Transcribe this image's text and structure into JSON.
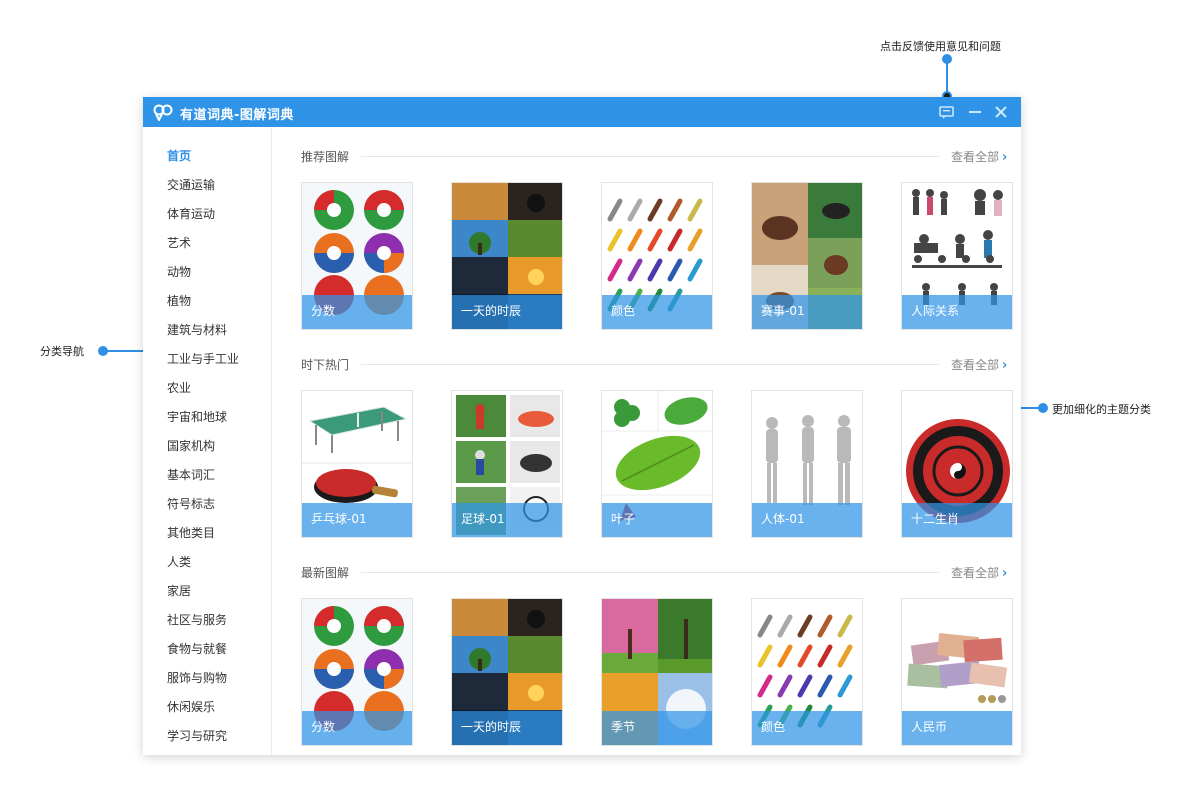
{
  "annotations": {
    "feedback": "点击反馈使用意见和问题",
    "nav": "分类导航",
    "subcategory": "更加细化的主题分类"
  },
  "window": {
    "title": "有道词典-图解词典"
  },
  "titlebar_icons": [
    "feedback-icon",
    "minimize-icon",
    "close-icon"
  ],
  "sidebar": {
    "items": [
      {
        "label": "首页",
        "active": true
      },
      {
        "label": "交通运输"
      },
      {
        "label": "体育运动"
      },
      {
        "label": "艺术"
      },
      {
        "label": "动物"
      },
      {
        "label": "植物"
      },
      {
        "label": "建筑与材料"
      },
      {
        "label": "工业与手工业"
      },
      {
        "label": "农业"
      },
      {
        "label": "宇宙和地球"
      },
      {
        "label": "国家机构"
      },
      {
        "label": "基本词汇"
      },
      {
        "label": "符号标志"
      },
      {
        "label": "其他类目"
      },
      {
        "label": "人类"
      },
      {
        "label": "家居"
      },
      {
        "label": "社区与服务"
      },
      {
        "label": "食物与就餐"
      },
      {
        "label": "服饰与购物"
      },
      {
        "label": "休闲娱乐"
      },
      {
        "label": "学习与研究"
      }
    ]
  },
  "sections": [
    {
      "title": "推荐图解",
      "view_all": "查看全部",
      "cards": [
        {
          "label": "分数",
          "thumb": "fractions"
        },
        {
          "label": "一天的时辰",
          "thumb": "times-of-day"
        },
        {
          "label": "颜色",
          "thumb": "colors"
        },
        {
          "label": "赛事-01",
          "thumb": "races"
        },
        {
          "label": "人际关系",
          "thumb": "people"
        }
      ]
    },
    {
      "title": "时下热门",
      "view_all": "查看全部",
      "cards": [
        {
          "label": "乒乓球-01",
          "thumb": "ping-pong"
        },
        {
          "label": "足球-01",
          "thumb": "football"
        },
        {
          "label": "叶子",
          "thumb": "leaves"
        },
        {
          "label": "人体-01",
          "thumb": "human-body"
        },
        {
          "label": "十二生肖",
          "thumb": "zodiac"
        }
      ]
    },
    {
      "title": "最新图解",
      "view_all": "查看全部",
      "cards": [
        {
          "label": "分数",
          "thumb": "fractions"
        },
        {
          "label": "一天的时辰",
          "thumb": "times-of-day"
        },
        {
          "label": "季节",
          "thumb": "seasons"
        },
        {
          "label": "颜色",
          "thumb": "colors"
        },
        {
          "label": "人民币",
          "thumb": "rmb"
        }
      ]
    }
  ],
  "colors": {
    "accent": "#2f94e8",
    "label_band": "#5bb4f0",
    "annotation": "#2f8fe6"
  }
}
